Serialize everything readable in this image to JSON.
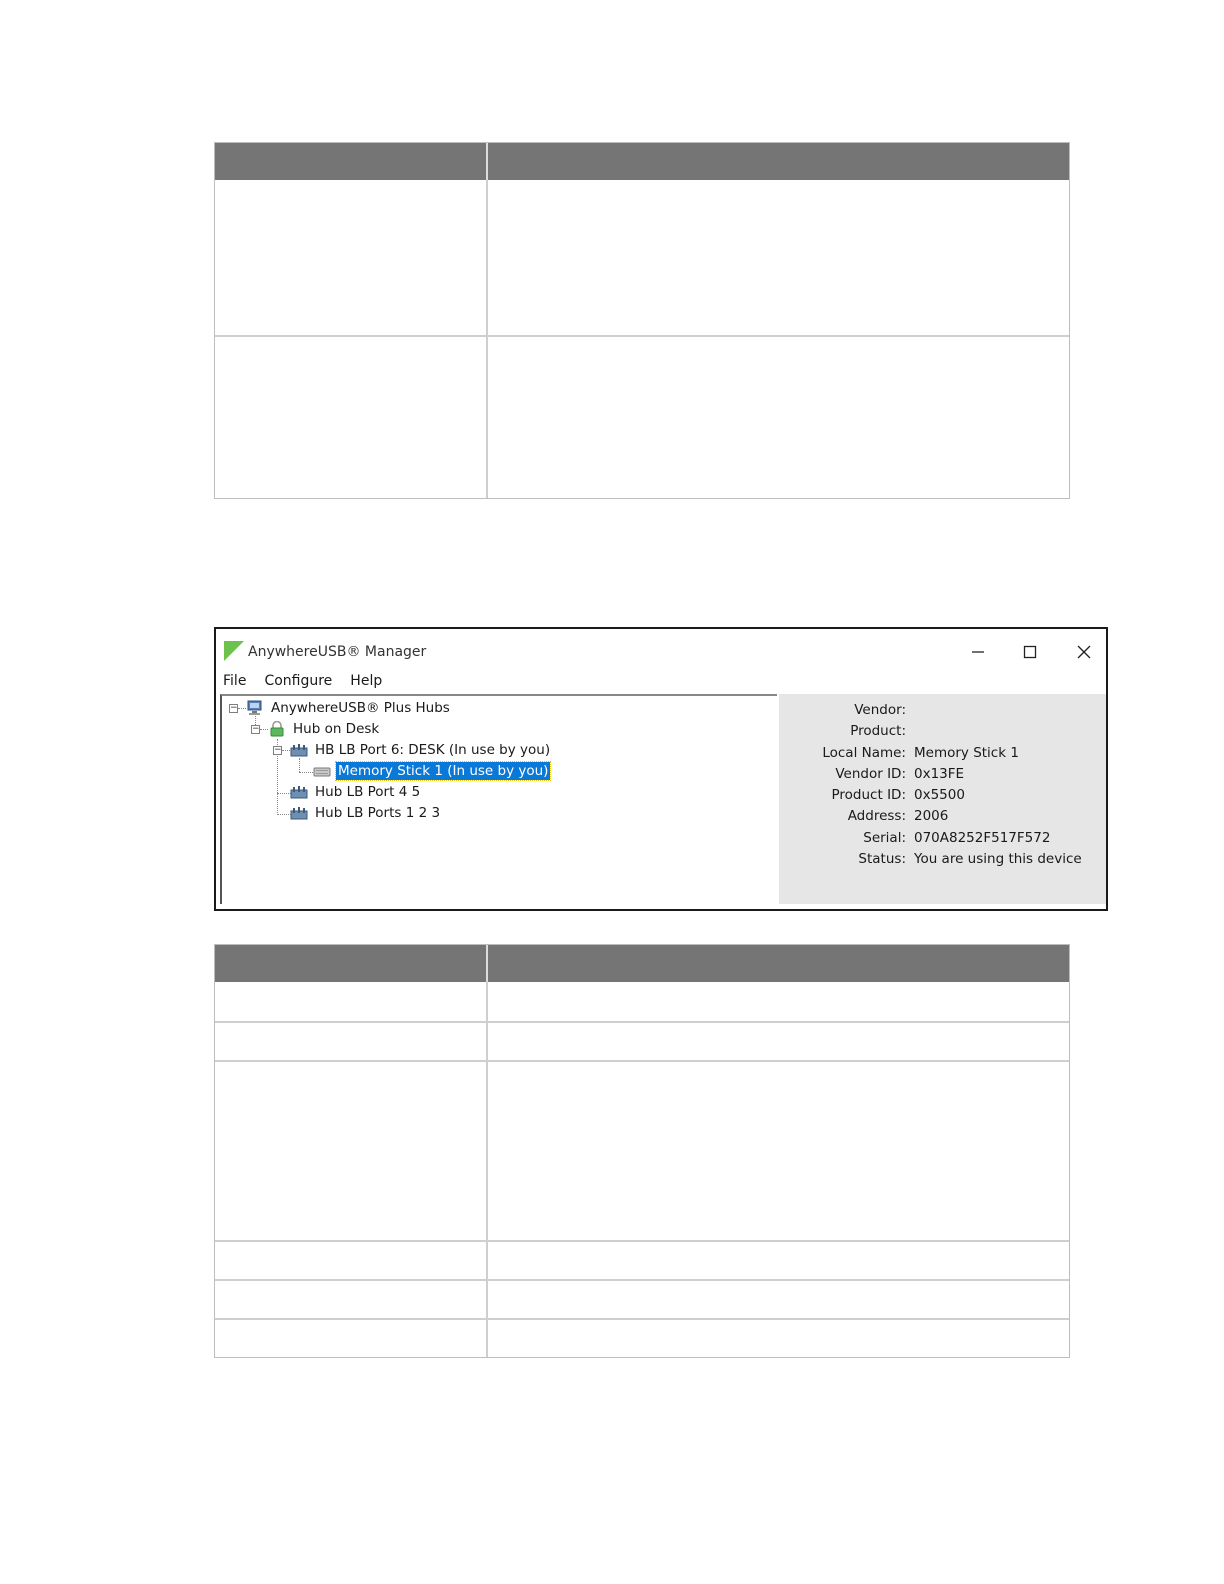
{
  "window": {
    "title": "AnywhereUSB® Manager",
    "controls": [
      "minimize-icon",
      "maximize-icon",
      "close-icon"
    ]
  },
  "menu": {
    "items": [
      "File",
      "Configure",
      "Help"
    ]
  },
  "tree": {
    "root": {
      "label": "AnywhereUSB® Plus Hubs",
      "icon": "computer-icon"
    },
    "hub": {
      "label": "Hub on Desk",
      "icon": "lock-icon"
    },
    "groups": [
      {
        "label": "HB LB Port 6: DESK  (In use by you)",
        "icon": "usb-group-icon"
      },
      {
        "label": "Hub LB Port 4 5",
        "icon": "usb-group-icon"
      },
      {
        "label": "Hub LB Ports 1 2 3",
        "icon": "usb-group-icon"
      }
    ],
    "device": {
      "label": "Memory Stick 1 (In use by you)",
      "icon": "memory-stick-icon",
      "selected": true
    }
  },
  "details": [
    {
      "key": "Vendor:",
      "value": ""
    },
    {
      "key": "Product:",
      "value": ""
    },
    {
      "key": "Local Name:",
      "value": "Memory Stick 1"
    },
    {
      "key": "Vendor ID:",
      "value": "0x13FE"
    },
    {
      "key": "Product ID:",
      "value": "0x5500"
    },
    {
      "key": "Address:",
      "value": "2006"
    },
    {
      "key": "Serial:",
      "value": "070A8252F517F572"
    },
    {
      "key": "Status:",
      "value": "You are using this device"
    }
  ],
  "colors": {
    "table_header": "#757575",
    "selection": "#0a78d7",
    "detail_background": "#e6e6e6",
    "logo": "#6cc24a"
  }
}
